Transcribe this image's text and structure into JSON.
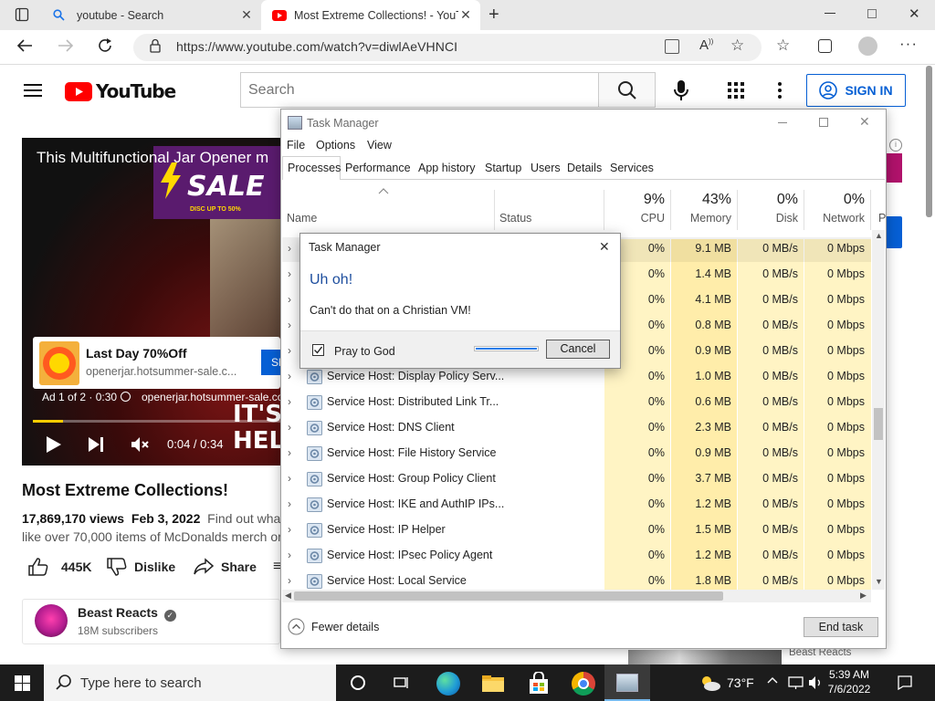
{
  "browser": {
    "tabs": [
      {
        "title": "youtube - Search",
        "favicon": "search-icon",
        "active": false
      },
      {
        "title": "Most Extreme Collections! - YouTube",
        "favicon": "youtube-icon",
        "active": true
      }
    ],
    "url": "https://www.youtube.com/watch?v=diwlAeVHNCI"
  },
  "youtube": {
    "logo_text": "YouTube",
    "search_placeholder": "Search",
    "signin_label": "SIGN IN",
    "video": {
      "overlay_title": "This Multifunctional Jar Opener m",
      "sale_text": "SALE",
      "sale_sub": "DISC UP TO 50%",
      "ad_title": "Last Day 70%Off",
      "ad_url": "openerjar.hotsummer-sale.c...",
      "ad_button": "Sh",
      "ad_info": "Ad 1 of 2 · 0:30",
      "ad_info_url": "openerjar.hotsummer-sale.com",
      "big_text_1": "IT'S",
      "big_text_2": "HELP",
      "time": "0:04 / 0:34",
      "progress_fraction": 0.12
    },
    "title": "Most Extreme Collections!",
    "views": "17,869,170 views",
    "date": "Feb 3, 2022",
    "desc_1": "Find out what'",
    "desc_2": "like over 70,000 items of McDonalds merch or",
    "likes": "445K",
    "dislike_label": "Dislike",
    "share_label": "Share",
    "channel": {
      "name": "Beast Reacts",
      "subs": "18M subscribers"
    },
    "right_channel": "Beast Reacts",
    "brand_color": "#ff0000",
    "accent_color": "#065fd4"
  },
  "taskmanager": {
    "title": "Task Manager",
    "menu": [
      "File",
      "Options",
      "View"
    ],
    "tabs": [
      "Processes",
      "Performance",
      "App history",
      "Startup",
      "Users",
      "Details",
      "Services"
    ],
    "columns": {
      "name": "Name",
      "status": "Status",
      "cpu_pct": "9%",
      "cpu": "CPU",
      "mem_pct": "43%",
      "mem": "Memory",
      "disk_pct": "0%",
      "disk": "Disk",
      "net_pct": "0%",
      "net": "Network",
      "more": "P"
    },
    "rows": [
      {
        "name": "",
        "cpu": "0%",
        "mem": "9.1 MB",
        "disk": "0 MB/s",
        "net": "0 Mbps"
      },
      {
        "name": "",
        "cpu": "0%",
        "mem": "1.4 MB",
        "disk": "0 MB/s",
        "net": "0 Mbps"
      },
      {
        "name": "",
        "cpu": "0%",
        "mem": "4.1 MB",
        "disk": "0 MB/s",
        "net": "0 Mbps"
      },
      {
        "name": "",
        "cpu": "0%",
        "mem": "0.8 MB",
        "disk": "0 MB/s",
        "net": "0 Mbps"
      },
      {
        "name": "",
        "cpu": "0%",
        "mem": "0.9 MB",
        "disk": "0 MB/s",
        "net": "0 Mbps"
      },
      {
        "name": "Service Host: Display Policy Serv...",
        "cpu": "0%",
        "mem": "1.0 MB",
        "disk": "0 MB/s",
        "net": "0 Mbps"
      },
      {
        "name": "Service Host: Distributed Link Tr...",
        "cpu": "0%",
        "mem": "0.6 MB",
        "disk": "0 MB/s",
        "net": "0 Mbps"
      },
      {
        "name": "Service Host: DNS Client",
        "cpu": "0%",
        "mem": "2.3 MB",
        "disk": "0 MB/s",
        "net": "0 Mbps"
      },
      {
        "name": "Service Host: File History Service",
        "cpu": "0%",
        "mem": "0.9 MB",
        "disk": "0 MB/s",
        "net": "0 Mbps"
      },
      {
        "name": "Service Host: Group Policy Client",
        "cpu": "0%",
        "mem": "3.7 MB",
        "disk": "0 MB/s",
        "net": "0 Mbps"
      },
      {
        "name": "Service Host: IKE and AuthIP IPs...",
        "cpu": "0%",
        "mem": "1.2 MB",
        "disk": "0 MB/s",
        "net": "0 Mbps"
      },
      {
        "name": "Service Host: IP Helper",
        "cpu": "0%",
        "mem": "1.5 MB",
        "disk": "0 MB/s",
        "net": "0 Mbps"
      },
      {
        "name": "Service Host: IPsec Policy Agent",
        "cpu": "0%",
        "mem": "1.2 MB",
        "disk": "0 MB/s",
        "net": "0 Mbps"
      },
      {
        "name": "Service Host: Local Service",
        "cpu": "0%",
        "mem": "1.8 MB",
        "disk": "0 MB/s",
        "net": "0 Mbps"
      }
    ],
    "fewer_details": "Fewer details",
    "end_task": "End task"
  },
  "dialog": {
    "title": "Task Manager",
    "heading": "Uh oh!",
    "message": "Can't do that on a Christian VM!",
    "checkbox_label": "Pray to God",
    "checkbox_checked": true,
    "cancel_label": "Cancel"
  },
  "taskbar": {
    "search_placeholder": "Type here to search",
    "temperature": "73°F",
    "time": "5:39 AM",
    "date": "7/6/2022"
  }
}
